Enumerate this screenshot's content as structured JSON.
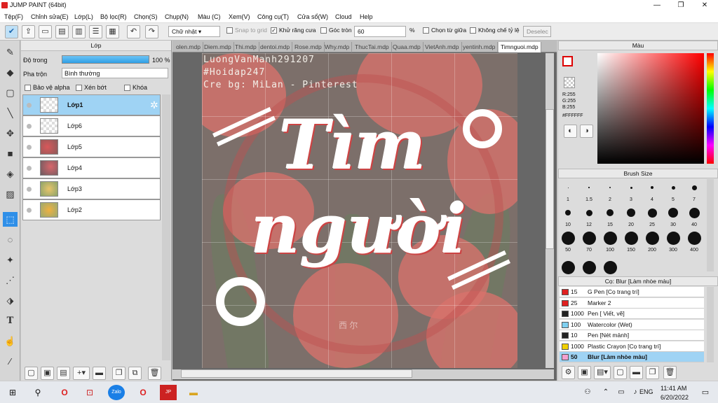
{
  "window": {
    "title": "JUMP PAINT (64bit)",
    "min": "—",
    "max": "❐",
    "close": "✕"
  },
  "menu": [
    "Tệp(F)",
    "Chỉnh sửa(E)",
    "Lớp(L)",
    "Bộ lọc(R)",
    "Chọn(S)",
    "Chụp(N)",
    "Màu (C)",
    "Xem(V)",
    "Công cụ(T)",
    "Cửa sổ(W)",
    "Cloud",
    "Help"
  ],
  "toolbar": {
    "shape": "Chữ nhật",
    "snap": "Snap to grid",
    "antialias": "Khử răng cưa",
    "round": "Góc tròn",
    "round_value": "60",
    "percent": "%",
    "center": "Chọn từ giữa",
    "fixed": "Không chế tỷ lệ",
    "deselect": "Deselec"
  },
  "layers": {
    "title": "Lớp",
    "opacity_label": "Độ trong",
    "opacity_value": "100 %",
    "blend_label": "Pha trộn",
    "blend_value": "Bình thường",
    "protect": "Bảo vệ alpha",
    "clip": "Xén bớt",
    "lock": "Khóa",
    "items": [
      {
        "name": "Lớp1"
      },
      {
        "name": "Lớp6"
      },
      {
        "name": "Lớp5"
      },
      {
        "name": "Lớp4"
      },
      {
        "name": "Lớp3"
      },
      {
        "name": "Lớp2"
      }
    ]
  },
  "tabs": [
    "olen.mdp",
    "Diem.mdp",
    "Thi.mdp",
    "dentoi.mdp",
    "Rose.mdp",
    "Why.mdp",
    "ThucTai.mdp",
    "Quaa.mdp",
    "VietAnh.mdp",
    "yentinh.mdp",
    "Timnguoi.mdp"
  ],
  "canvas": {
    "line1": "LuongVanManh291207",
    "line2": "#Hoidap247",
    "line3": "Cre bg:  MiLan - Pinterest",
    "title1": "Tìm",
    "title2": "người",
    "watermark": "西 尔"
  },
  "color": {
    "title": "Màu",
    "r": "R:255",
    "g": "G:255",
    "b": "B:255",
    "hex": "#FFFFFF"
  },
  "brushsize": {
    "title": "Brush Size",
    "sizes": [
      "1",
      "1.5",
      "2",
      "3",
      "4",
      "5",
      "7",
      "10",
      "12",
      "15",
      "20",
      "25",
      "30",
      "40",
      "50",
      "70",
      "100",
      "150",
      "200",
      "300",
      "400"
    ],
    "extra_dots": 3
  },
  "brushes": {
    "title": "Cọ: Blur [Làm nhòe màu]",
    "items": [
      {
        "size": "15",
        "name": "G Pen [Cọ trang trí]",
        "color": "#e02020"
      },
      {
        "size": "25",
        "name": "Marker 2",
        "color": "#e02020"
      },
      {
        "size": "1000",
        "name": "Pen [ Viết, vẽ]",
        "color": "#222222"
      },
      {
        "size": "100",
        "name": "Watercolor (Wet)",
        "color": "#7fd0f0"
      },
      {
        "size": "10",
        "name": "Pen [Nét mảnh]",
        "color": "#222222"
      },
      {
        "size": "1000",
        "name": "Plastic Crayon [Cọ trang trí]",
        "color": "#f0d000"
      },
      {
        "size": "50",
        "name": "Blur [Làm nhòe màu]",
        "color": "#f4a0d0"
      }
    ]
  },
  "taskbar": {
    "time": "11:41 AM",
    "date": "6/20/2022",
    "lang": "ENG"
  }
}
